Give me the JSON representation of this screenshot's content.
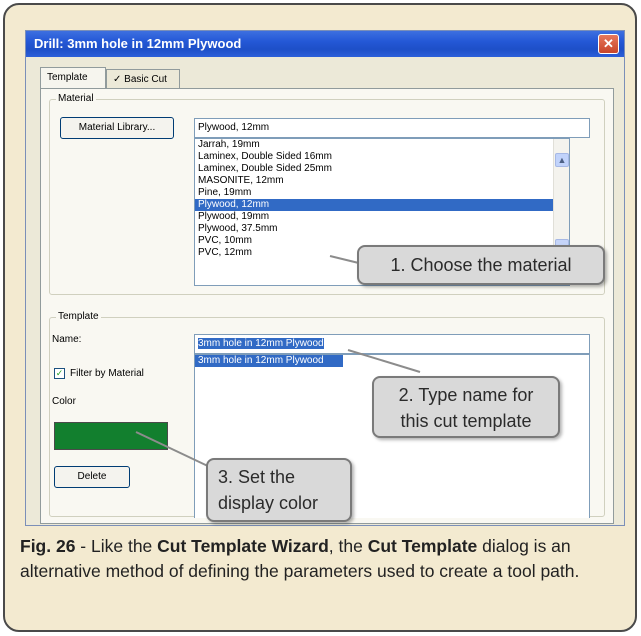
{
  "dialog": {
    "title": "Drill: 3mm hole in 12mm Plywood",
    "close_glyph": "✕",
    "tabs": [
      {
        "label": "Template"
      },
      {
        "label": "✓ Basic Cut"
      }
    ]
  },
  "material": {
    "group_label": "Material",
    "library_button": "Material Library...",
    "selected_value": "Plywood, 12mm",
    "items": [
      "Jarrah, 19mm",
      "Laminex, Double Sided 16mm",
      "Laminex, Double Sided 25mm",
      "MASONITE, 12mm",
      "Pine, 19mm",
      "Plywood, 12mm",
      "Plywood, 19mm",
      "Plywood, 37.5mm",
      "PVC, 10mm",
      "PVC, 12mm"
    ],
    "selected_index": 5
  },
  "template": {
    "group_label": "Template",
    "name_label": "Name:",
    "name_value": "3mm hole in 12mm Plywood",
    "filter_label": "Filter by Material",
    "filter_checked": true,
    "color_label": "Color",
    "color_value": "#127f2e",
    "delete_button": "Delete",
    "items": [
      "3mm hole in 12mm Plywood"
    ]
  },
  "callouts": {
    "c1": "1. Choose the material",
    "c2_line1": "2. Type name for",
    "c2_line2": "this cut template",
    "c3_line1": "3. Set the",
    "c3_line2": "display color"
  },
  "caption": {
    "fig": "Fig. 26",
    "t1": " - Like the ",
    "b1": "Cut Template Wizard",
    "t2": ", the ",
    "b2": "Cut Template",
    "t3": " dialog is an alternative method of defining the parameters used to create a tool path."
  }
}
